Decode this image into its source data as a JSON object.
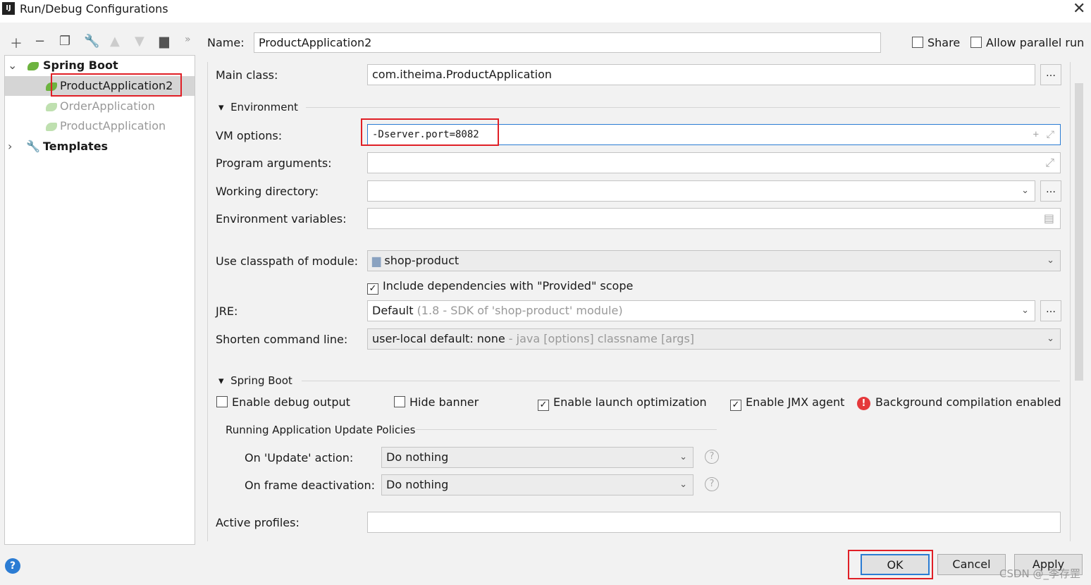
{
  "window": {
    "title": "Run/Debug Configurations",
    "logo": "IJ"
  },
  "toolbar": {
    "icons": [
      "plus-icon",
      "minus-icon",
      "copy-icon",
      "wrench-icon",
      "arrow-up-icon",
      "arrow-down-icon",
      "folder-add-icon",
      "more-icon"
    ]
  },
  "tree": {
    "spring_boot": "Spring Boot",
    "items": [
      {
        "label": "ProductApplication2",
        "selected": true
      },
      {
        "label": "OrderApplication"
      },
      {
        "label": "ProductApplication"
      }
    ],
    "templates": "Templates"
  },
  "header": {
    "name_label": "Name:",
    "name_value": "ProductApplication2",
    "share": "Share",
    "parallel": "Allow parallel run"
  },
  "form": {
    "main_class_label": "Main class:",
    "main_class": "com.itheima.ProductApplication",
    "environment": "Environment",
    "vm_label": "VM options:",
    "vm_value": "-Dserver.port=8082",
    "args_label": "Program arguments:",
    "args_value": "",
    "workdir_label": "Working directory:",
    "workdir_value": "",
    "env_label": "Environment variables:",
    "env_value": "",
    "module_label": "Use classpath of module:",
    "module_value": "shop-product",
    "include_deps": "Include dependencies with \"Provided\" scope",
    "jre_label": "JRE:",
    "jre_value": "Default",
    "jre_hint": "(1.8 - SDK of 'shop-product' module)",
    "shorten_label": "Shorten command line:",
    "shorten_value": "user-local default: none",
    "shorten_hint": " - java [options] classname [args]"
  },
  "spring": {
    "section": "Spring Boot",
    "debug": "Enable debug output",
    "banner": "Hide banner",
    "launch": "Enable launch optimization",
    "jmx": "Enable JMX agent",
    "bg": "Background compilation enabled",
    "policies": "Running Application Update Policies",
    "update_label": "On 'Update' action:",
    "update_value": "Do nothing",
    "frame_label": "On frame deactivation:",
    "frame_value": "Do nothing",
    "profiles_label": "Active profiles:",
    "profiles_value": ""
  },
  "buttons": {
    "ok": "OK",
    "cancel": "Cancel",
    "apply": "Apply"
  },
  "watermark": "CSDN @_李存罡",
  "colors": {
    "highlight": "#e01f26",
    "focus": "#2b7cd3",
    "spring": "#6db33f"
  }
}
